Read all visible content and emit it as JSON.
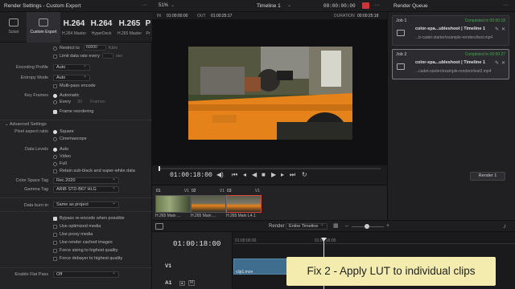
{
  "left_panel": {
    "title": "Render Settings - Custom Export",
    "presets": [
      {
        "big": "",
        "label": "Sutari"
      },
      {
        "big": "",
        "label": "Custom Export"
      },
      {
        "big": "H.264",
        "label": "H.264 Master"
      },
      {
        "big": "H.264",
        "label": "HyperDeck"
      },
      {
        "big": "H.265",
        "label": "H.265 Master"
      },
      {
        "big": "P",
        "label": "Pr"
      }
    ],
    "restrict_to_label": "Restrict to",
    "restrict_value": "60000",
    "restrict_unit": "Kb/s",
    "limit_label": "Limit data rate every",
    "limit_unit": "sec",
    "encoding_profile_label": "Encoding Profile",
    "encoding_profile_value": "Auto",
    "entropy_mode_label": "Entropy Mode",
    "entropy_mode_value": "Auto",
    "multipass_label": "Multi-pass encode",
    "key_frames_label": "Key Frames",
    "key_automatic": "Automatic",
    "key_every": "Every",
    "key_every_value": "30",
    "key_frames_unit": "Frames",
    "frame_reordering": "Frame reordering",
    "advanced_settings": "Advanced Settings",
    "pixel_aspect_label": "Pixel aspect ratio",
    "pixel_square": "Square",
    "pixel_cinemascope": "Cinemascope",
    "data_levels_label": "Data Levels",
    "levels": [
      "Auto",
      "Video",
      "Full"
    ],
    "retain_label": "Retain sub-black and super-white data",
    "color_space_label": "Color Space Tag",
    "color_space_value": "Rec.2020",
    "gamma_label": "Gamma Tag",
    "gamma_value": "ARIB STD-B67 HLG",
    "data_burnin_label": "Data burn-in",
    "data_burnin_value": "Same as project",
    "options": [
      "Bypass re-encode when possible",
      "Use optimized media",
      "Use proxy media",
      "Use render cached images",
      "Force sizing to highest quality",
      "Force debayer to highest quality"
    ],
    "enable_flat_pass_label": "Enable Flat Pass",
    "enable_flat_pass_value": "Off"
  },
  "viewer": {
    "zoom": "51%",
    "timeline_name": "Timeline 1",
    "tc_top": "00:00:00:00",
    "in_label": "IN",
    "in_tc": "01:00:00:00",
    "out_label": "OUT",
    "out_tc": "01:00:25:17",
    "duration_label": "DURATION",
    "duration_tc": "00:00:25:18",
    "current_tc": "01:00:18:00"
  },
  "thumbnails": [
    {
      "num": "01",
      "track": "V1",
      "caption": "H.265 Main ..."
    },
    {
      "num": "02",
      "track": "V1",
      "caption": "H.265 Main ..."
    },
    {
      "num": "03",
      "track": "V1",
      "caption": "H.265 Main L4.1"
    }
  ],
  "timeline_bar": {
    "render_label": "Render",
    "render_value": "Entire Timeline"
  },
  "timeline": {
    "timecode": "01:00:18:00",
    "ruler": [
      "01:00:00:00",
      "01:00:16:00"
    ],
    "tracks": [
      "V1",
      "A1"
    ],
    "clip_name": "clip1.mov"
  },
  "render_queue": {
    "title": "Render Queue",
    "jobs": [
      {
        "title": "Job 1",
        "status": "Completed in 00:00:18",
        "name": "color-spa...ubleshoot | Timeline 1",
        "path": "...b-cadet-starter/example-renders/test.mp4"
      },
      {
        "title": "Job 2",
        "status": "Completed in 00:00:27",
        "name": "color-spa...ubleshoot | Timeline 1",
        "path": "...cadet-starter/example-renders/test2.mp4"
      }
    ],
    "render_button": "Render 1"
  },
  "caption": "Fix 2 - Apply LUT to individual clips",
  "colors": {
    "accent_orange": "#e5821a",
    "completed_green": "#42a84a",
    "caption_bg": "#f3ecae"
  }
}
